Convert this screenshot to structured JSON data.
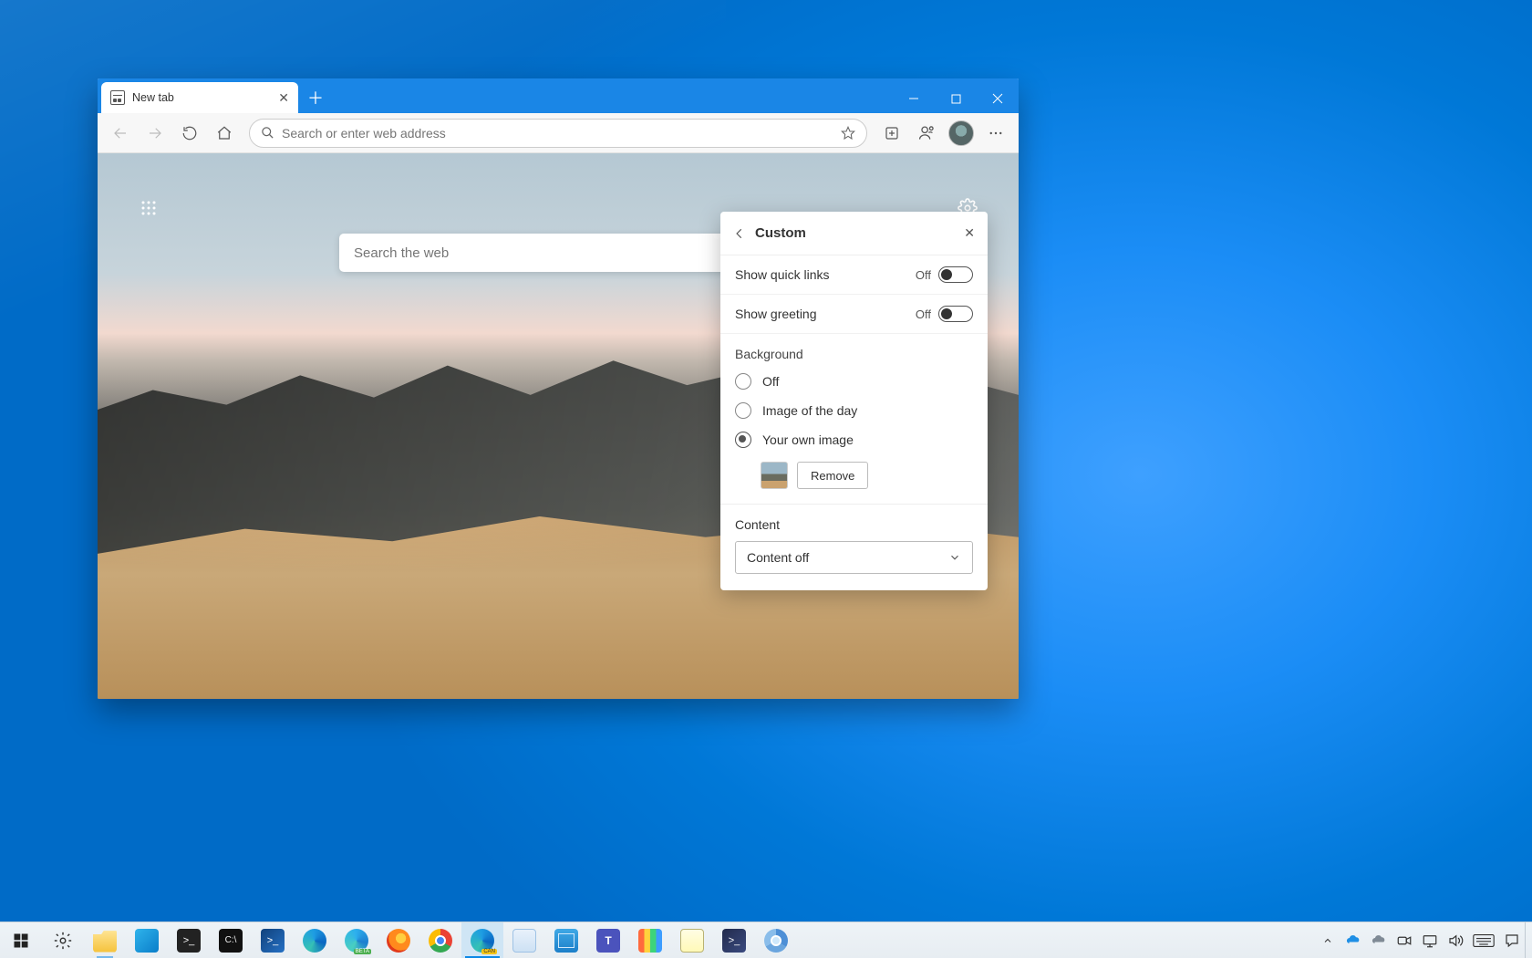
{
  "browser": {
    "tab_title": "New tab",
    "address_placeholder": "Search or enter web address",
    "ntp_search_placeholder": "Search the web"
  },
  "panel": {
    "title": "Custom",
    "quick_links_label": "Show quick links",
    "quick_links_state": "Off",
    "greeting_label": "Show greeting",
    "greeting_state": "Off",
    "background_heading": "Background",
    "bg_option_off": "Off",
    "bg_option_iotd": "Image of the day",
    "bg_option_own": "Your own image",
    "remove_label": "Remove",
    "content_heading": "Content",
    "content_value": "Content off"
  },
  "taskbar": {
    "time": "",
    "date": ""
  }
}
